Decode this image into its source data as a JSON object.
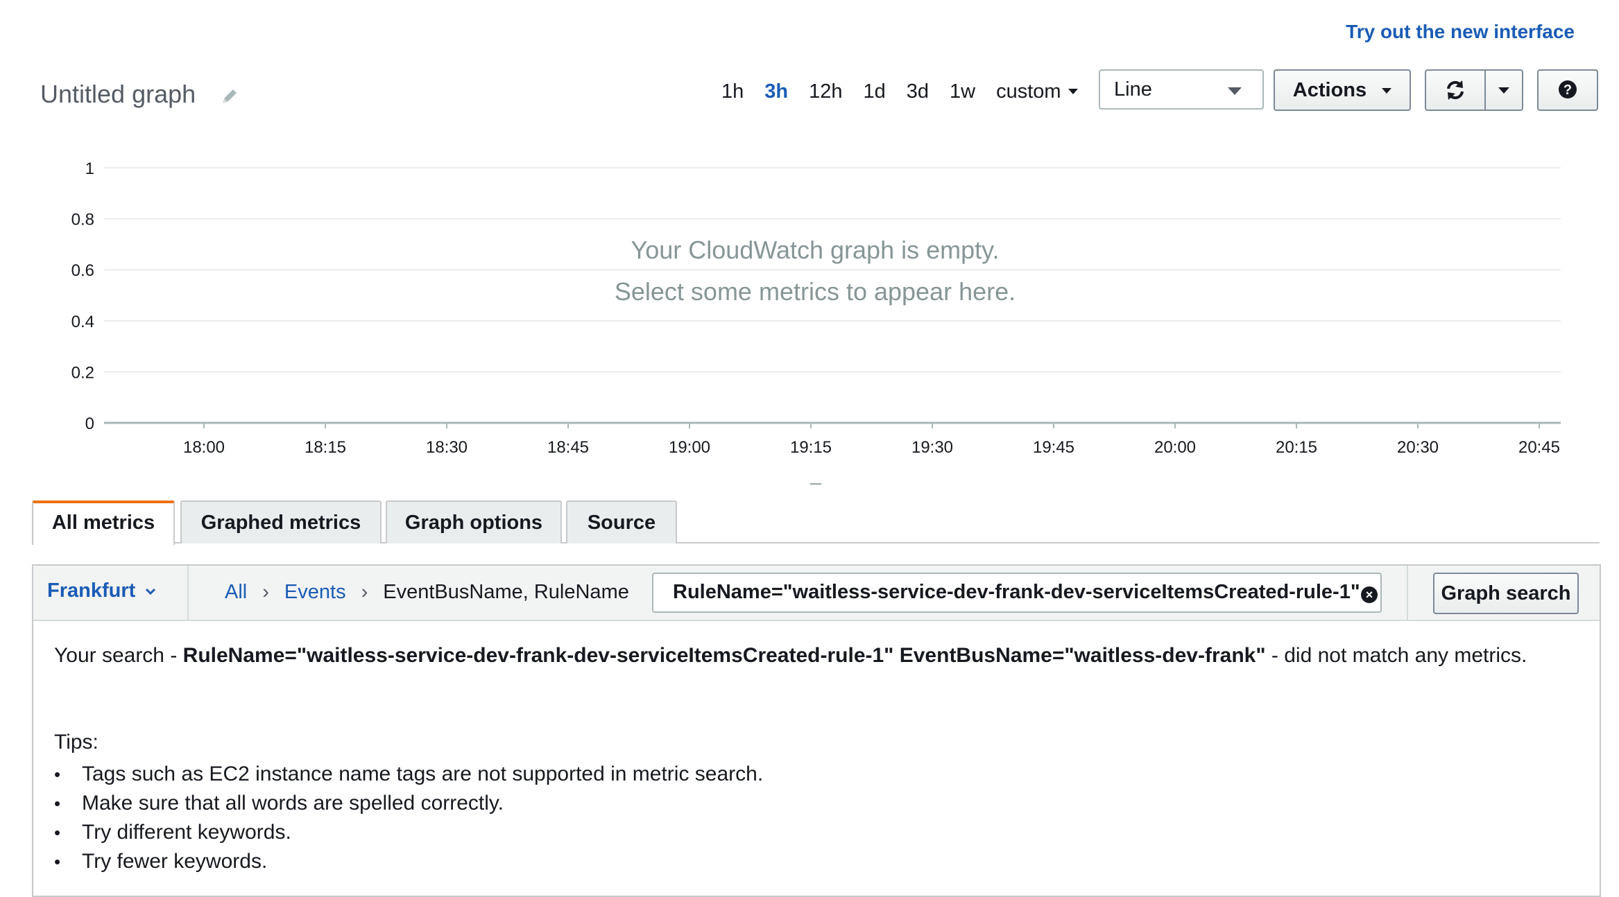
{
  "header": {
    "try_link": "Try out the new interface",
    "graph_title": "Untitled graph",
    "time_ranges": [
      "1h",
      "3h",
      "12h",
      "1d",
      "3d",
      "1w"
    ],
    "active_range": "3h",
    "custom_label": "custom",
    "graph_type": "Line",
    "actions_label": "Actions",
    "icons": {
      "edit": "pencil-icon",
      "refresh": "refresh-icon",
      "refresh_menu": "caret-down-icon",
      "help": "question-circle-icon"
    }
  },
  "chart_data": {
    "type": "line",
    "title": "",
    "xlabel": "",
    "ylabel": "",
    "series": [],
    "x_ticks": [
      "18:00",
      "18:15",
      "18:30",
      "18:45",
      "19:00",
      "19:15",
      "19:30",
      "19:45",
      "20:00",
      "20:15",
      "20:30",
      "20:45"
    ],
    "y_ticks": [
      "0",
      "0.2",
      "0.4",
      "0.6",
      "0.8",
      "1"
    ],
    "ylim": [
      0,
      1
    ],
    "grid": true,
    "empty_message_line1": "Your CloudWatch graph is empty.",
    "empty_message_line2": "Select some metrics to appear here."
  },
  "resize_handle": "---",
  "tabs": [
    {
      "label": "All metrics",
      "active": true
    },
    {
      "label": "Graphed metrics",
      "active": false
    },
    {
      "label": "Graph options",
      "active": false
    },
    {
      "label": "Source",
      "active": false
    }
  ],
  "browser": {
    "region": "Frankfurt",
    "breadcrumb": {
      "all": "All",
      "namespace": "Events",
      "dimensions": "EventBusName, RuleName"
    },
    "search_value": "RuleName=\"waitless-service-dev-frank-dev-serviceItemsCreated-rule-1\" EventBusName=\"waitless-dev-frank\"",
    "graph_search_label": "Graph search"
  },
  "result": {
    "prefix": "Your search - ",
    "query": "RuleName=\"waitless-service-dev-frank-dev-serviceItemsCreated-rule-1\" EventBusName=\"waitless-dev-frank\"",
    "suffix": " - did not match any metrics.",
    "tips_title": "Tips:",
    "tips": [
      "Tags such as EC2 instance name tags are not supported in metric search.",
      "Make sure that all words are spelled correctly.",
      "Try different keywords.",
      "Try fewer keywords."
    ]
  }
}
